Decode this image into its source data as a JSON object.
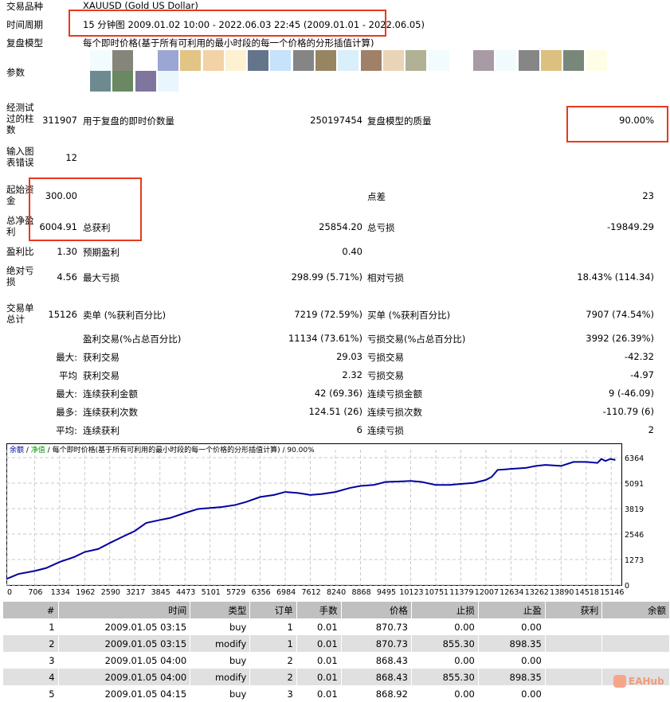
{
  "summary": {
    "symbol_label": "交易品种",
    "symbol": "XAUUSD (Gold US Dollar)",
    "period_label": "时间周期",
    "period": "15 分钟图 2009.01.02 10:00 - 2022.06.03 22:45 (2009.01.01 - 2022.06.05)",
    "model_label": "复盘模型",
    "model": "每个即时价格(基于所有可利用的最小时段的每一个价格的分形插值计算)",
    "params_label": "参数",
    "bars_label": "经测试过的柱数",
    "bars": "311907",
    "ticks_label": "用于复盘的即时价数量",
    "ticks": "250197454",
    "quality_label": "复盘模型的质量",
    "quality": "90.00%",
    "errors_label": "输入图表错误",
    "errors": "12",
    "deposit_label": "起始资金",
    "deposit": "300.00",
    "spread_label": "点差",
    "spread": "23",
    "net_label": "总净盈利",
    "net": "6004.91",
    "gross_profit_label": "总获利",
    "gross_profit": "25854.20",
    "gross_loss_label": "总亏损",
    "gross_loss": "-19849.29",
    "pf_label": "盈利比",
    "pf": "1.30",
    "expected_label": "预期盈利",
    "expected": "0.40",
    "abs_dd_label": "绝对亏损",
    "abs_dd": "4.56",
    "max_dd_label": "最大亏损",
    "max_dd": "298.99 (5.71%)",
    "rel_dd_label": "相对亏损",
    "rel_dd": "18.43% (114.34)",
    "trades_label": "交易单总计",
    "trades": "15126",
    "short_label": "卖单 (%获利百分比)",
    "short": "7219 (72.59%)",
    "long_label": "买单 (%获利百分比)",
    "long": "7907 (74.54%)",
    "win_label": "盈利交易(%占总百分比)",
    "win": "11134 (73.61%)",
    "loss_label": "亏损交易(%占总百分比)",
    "loss": "3992 (26.39%)",
    "max_label": "最大:",
    "lg_win_label": "获利交易",
    "lg_win": "29.03",
    "lg_loss_label": "亏损交易",
    "lg_loss": "-42.32",
    "avg_label": "平均",
    "avg_win_label": "获利交易",
    "avg_win": "2.32",
    "avg_loss_label": "亏损交易",
    "avg_loss": "-4.97",
    "max2_label": "最大:",
    "cons_win_amt_label": "连续获利金额",
    "cons_win_amt": "42 (69.36)",
    "cons_loss_amt_label": "连续亏损金额",
    "cons_loss_amt": "9 (-46.09)",
    "most_label": "最多:",
    "cons_win_cnt_label": "连续获利次数",
    "cons_win_cnt": "124.51 (26)",
    "cons_loss_cnt_label": "连续亏损次数",
    "cons_loss_cnt": "-110.79 (6)",
    "avg2_label": "平均:",
    "avg_cons_win_label": "连续获利",
    "avg_cons_win": "6",
    "avg_cons_loss_label": "连续亏损",
    "avg_cons_loss": "2"
  },
  "param_swatches": [
    "#f2fbfd",
    "#85857a",
    "#ffffff",
    "#9ba6d4",
    "#e2c484",
    "#f3d2a8",
    "#fdf1d2",
    "#64748a",
    "#c6e3fb",
    "#858585",
    "#978561",
    "#d9effa",
    "#a08068",
    "#ead4b7",
    "#b1b196",
    "#f2fcfe",
    "#ffffff",
    "#a89ba5",
    "#f1fbfd",
    "#868686",
    "#dcc07f",
    "#778779",
    "#fefde6"
  ],
  "param_swatches2": [
    "#6e8a91",
    "#688961",
    "#7f759d",
    "#eaf6fe"
  ],
  "chart_data": {
    "type": "line",
    "legend": {
      "balance": "余额",
      "sep1": " / ",
      "equity": "净值",
      "sep2": " / ",
      "model": "每个即时价格(基于所有可利用的最小时段的每一个价格的分形插值计算)",
      "sep3": " / ",
      "quality": "90.00%"
    },
    "x_ticks": [
      0,
      706,
      1334,
      1962,
      2590,
      3217,
      3845,
      4473,
      5101,
      5729,
      6356,
      6984,
      7612,
      8240,
      8868,
      9495,
      10123,
      10751,
      11379,
      12007,
      12634,
      13262,
      13890,
      14518,
      15146
    ],
    "y_ticks": [
      0,
      1273,
      2546,
      3819,
      5091,
      6364
    ],
    "xlim": [
      0,
      15400
    ],
    "ylim": [
      0,
      6364
    ],
    "series": [
      {
        "name": "余额",
        "color": "#0000a0",
        "x": [
          0,
          300,
          706,
          1000,
          1334,
          1700,
          1962,
          2300,
          2590,
          2900,
          3217,
          3500,
          3845,
          4100,
          4473,
          4800,
          5101,
          5400,
          5729,
          6000,
          6356,
          6700,
          6984,
          7300,
          7612,
          7900,
          8240,
          8600,
          8868,
          9200,
          9495,
          9800,
          10123,
          10400,
          10751,
          11100,
          11379,
          11700,
          12007,
          12150,
          12300,
          12634,
          13000,
          13262,
          13500,
          13890,
          14200,
          14518,
          14800,
          14900,
          15000,
          15126,
          15250
        ],
        "y": [
          300,
          550,
          700,
          850,
          1150,
          1400,
          1650,
          1800,
          2100,
          2400,
          2700,
          3100,
          3250,
          3350,
          3600,
          3800,
          3850,
          3900,
          4000,
          4150,
          4400,
          4500,
          4650,
          4600,
          4500,
          4550,
          4650,
          4850,
          4950,
          5000,
          5150,
          5170,
          5200,
          5150,
          5000,
          5000,
          5050,
          5100,
          5250,
          5400,
          5750,
          5800,
          5850,
          5950,
          6000,
          5950,
          6150,
          6150,
          6100,
          6300,
          6200,
          6300,
          6250
        ]
      }
    ]
  },
  "trades_table": {
    "headers": [
      "#",
      "时间",
      "类型",
      "订单",
      "手数",
      "价格",
      "止损",
      "止盈",
      "获利",
      "余额"
    ],
    "rows": [
      [
        "1",
        "2009.01.05 03:15",
        "buy",
        "1",
        "0.01",
        "870.73",
        "0.00",
        "0.00",
        "",
        ""
      ],
      [
        "2",
        "2009.01.05 03:15",
        "modify",
        "1",
        "0.01",
        "870.73",
        "855.30",
        "898.35",
        "",
        ""
      ],
      [
        "3",
        "2009.01.05 04:00",
        "buy",
        "2",
        "0.01",
        "868.43",
        "0.00",
        "0.00",
        "",
        ""
      ],
      [
        "4",
        "2009.01.05 04:00",
        "modify",
        "2",
        "0.01",
        "868.43",
        "855.30",
        "898.35",
        "",
        ""
      ],
      [
        "5",
        "2009.01.05 04:15",
        "buy",
        "3",
        "0.01",
        "868.92",
        "0.00",
        "0.00",
        "",
        ""
      ]
    ]
  },
  "watermark": "EAHub"
}
